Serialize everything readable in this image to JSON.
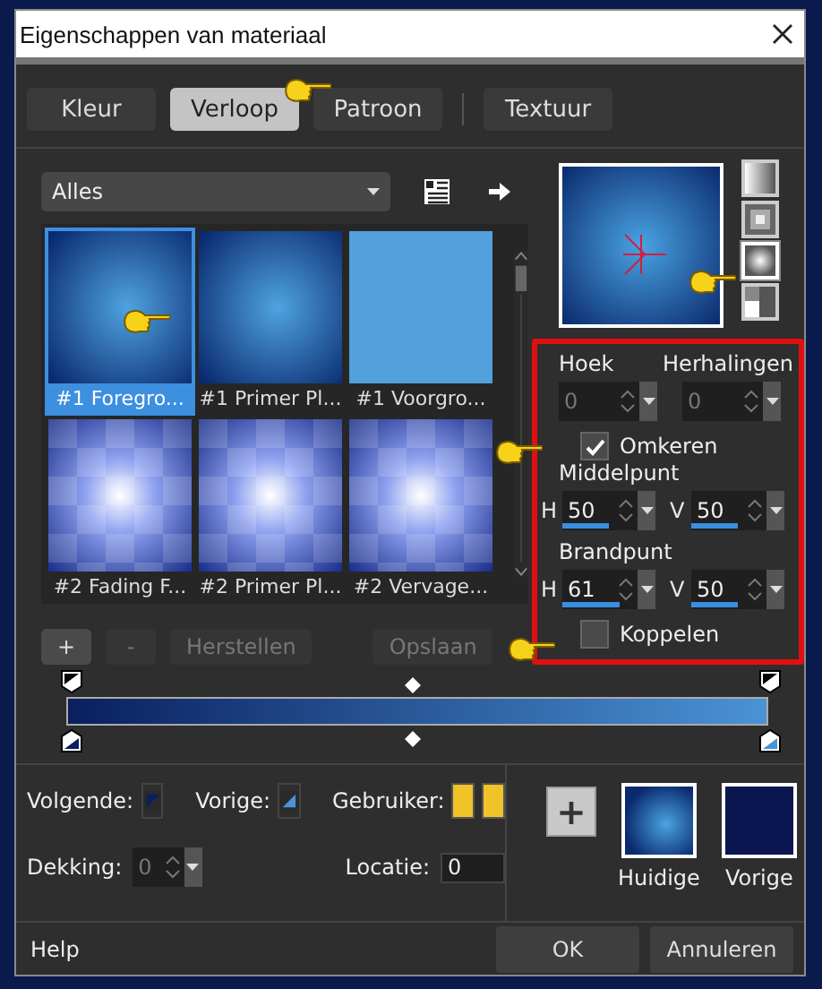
{
  "window": {
    "title": "Eigenschappen van materiaal"
  },
  "tabs": [
    {
      "label": "Kleur",
      "selected": false
    },
    {
      "label": "Verloop",
      "selected": true
    },
    {
      "label": "Patroon",
      "selected": false
    },
    {
      "label": "Textuur",
      "selected": false
    }
  ],
  "category": {
    "value": "Alles"
  },
  "gradients": [
    {
      "label": "#1 Foregro...",
      "kind": "radial",
      "selected": true
    },
    {
      "label": "#1 Primer Pl...",
      "kind": "radial",
      "selected": false
    },
    {
      "label": "#1 Voorgro...",
      "kind": "flat",
      "selected": false
    },
    {
      "label": "#2 Fading F...",
      "kind": "checker",
      "selected": false
    },
    {
      "label": "#2 Primer Pl...",
      "kind": "checker",
      "selected": false
    },
    {
      "label": "#2 Vervage...",
      "kind": "checker",
      "selected": false
    }
  ],
  "list_buttons": [
    {
      "label": "+",
      "disabled": false
    },
    {
      "label": "-",
      "disabled": true
    },
    {
      "label": "Herstellen",
      "disabled": true
    },
    {
      "label": "Opslaan",
      "disabled": true
    }
  ],
  "styles": [
    {
      "kind": "linear",
      "selected": false
    },
    {
      "kind": "rectangular",
      "selected": false
    },
    {
      "kind": "radial",
      "selected": true
    },
    {
      "kind": "corner",
      "selected": false
    }
  ],
  "settings": {
    "angle": {
      "label": "Hoek",
      "value": "0",
      "disabled": true
    },
    "repeats": {
      "label": "Herhalingen",
      "value": "0",
      "disabled": true
    },
    "invert": {
      "label": "Omkeren",
      "checked": true
    },
    "center": {
      "label": "Middelpunt",
      "fields": [
        {
          "prefix": "H",
          "value": "50",
          "level": 0.5
        },
        {
          "prefix": "V",
          "value": "50",
          "level": 0.5
        }
      ]
    },
    "focal": {
      "label": "Brandpunt",
      "fields": [
        {
          "prefix": "H",
          "value": "61",
          "level": 0.61
        },
        {
          "prefix": "V",
          "value": "50",
          "level": 0.5
        }
      ]
    },
    "link": {
      "label": "Koppelen",
      "checked": false
    }
  },
  "stop_fields": {
    "next": "Volgende:",
    "previous": "Vorige:",
    "user": "Gebruiker:",
    "opacity": {
      "label": "Dekking:",
      "value": "0",
      "disabled": true
    },
    "location": {
      "label": "Locatie:",
      "value": "0"
    }
  },
  "swatches": [
    {
      "label": "Huidige",
      "kind": "gradient"
    },
    {
      "label": "Vorige",
      "kind": "solid"
    }
  ],
  "add_button": {
    "label": "+"
  },
  "footer": {
    "help": "Help",
    "buttons": [
      {
        "label": "OK"
      },
      {
        "label": "Annuleren"
      }
    ]
  }
}
